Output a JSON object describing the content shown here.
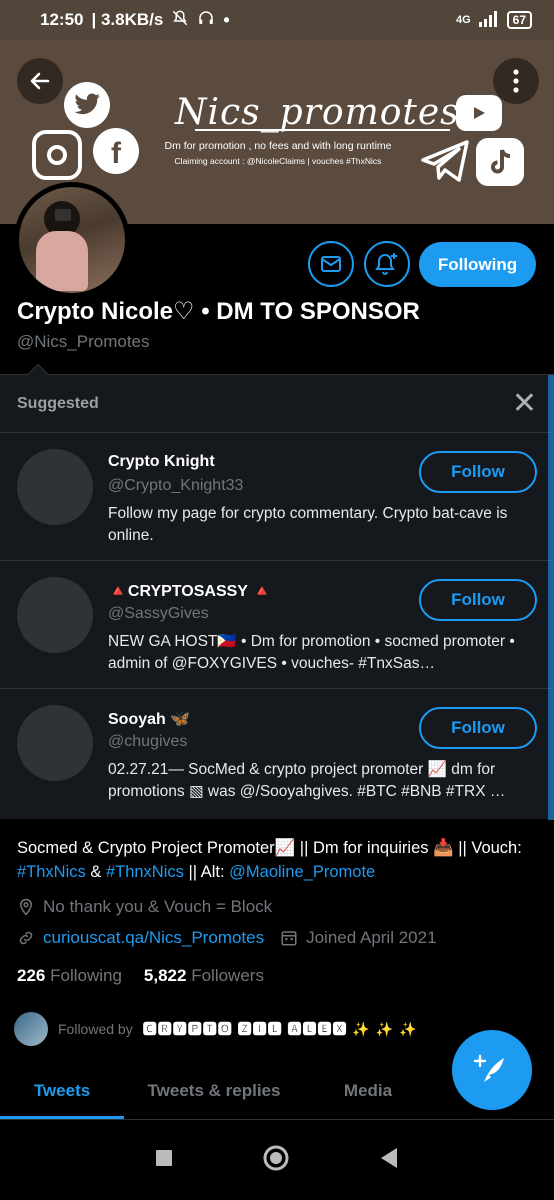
{
  "status": {
    "time": "12:50",
    "speed": "| 3.8KB/s",
    "network": "4G",
    "battery": "67"
  },
  "banner": {
    "title": "Nics_promotes",
    "line1": "Dm for promotion , no fees and with long runtime",
    "line2": "Claiming account : @NicoleClaims | vouches #ThxNics"
  },
  "profile": {
    "name": "Crypto Nicole♡ • DM TO SPONSOR",
    "handle": "@Nics_Promotes",
    "following_label": "Following"
  },
  "suggested": {
    "label": "Suggested",
    "follow_label": "Follow",
    "items": [
      {
        "name": "Crypto Knight",
        "handle": "@Crypto_Knight33",
        "bio": "Follow my page for crypto commentary. Crypto bat-cave is online."
      },
      {
        "name": "🔺CRYPTOSASSY 🔺",
        "handle": "@SassyGives",
        "bio": "NEW GA HOST🇵🇭 • Dm for promotion • socmed promoter • admin of @FOXYGIVES • vouches- #TnxSas…"
      },
      {
        "name": "Sooyah 🦋",
        "handle": "@chugives",
        "bio": "02.27.21— SocMed & crypto project promoter 📈 dm for promotions ▧ was @/Sooyahgives.  #BTC #BNB #TRX …"
      }
    ]
  },
  "bio": {
    "part1": "Socmed & Crypto Project Promoter📈 || Dm for inquiries 📥 || Vouch: ",
    "tag1": "#ThxNics",
    "amp": " & ",
    "tag2": "#ThnxNics",
    "part2": " || Alt: ",
    "alt": "@Maoline_Promote"
  },
  "meta": {
    "location": "No thank you & Vouch = Block",
    "link": "curiouscat.qa/Nics_Promotes",
    "joined": "Joined April 2021"
  },
  "stats": {
    "following_count": "226",
    "following_label": "Following",
    "followers_count": "5,822",
    "followers_label": "Followers"
  },
  "followed_by": {
    "label": "Followed by",
    "name": "🅲🆁🆈🅿🆃🅾 🆉🅸🅻 🅰🅻🅴🆇 ✨ ✨ ✨"
  },
  "tabs": [
    "Tweets",
    "Tweets & replies",
    "Media"
  ],
  "colors": {
    "accent": "#1d9bf0",
    "banner": "#5b4b3e",
    "card": "#15181c"
  }
}
